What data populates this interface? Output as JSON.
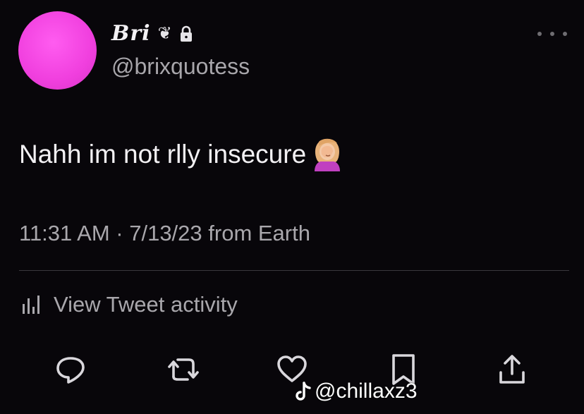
{
  "profile": {
    "display_name": "Bri",
    "name_glyph": "❦",
    "handle": "@brixquotess",
    "avatar_color": "#f03fde"
  },
  "tweet": {
    "text": "Nahh im not rlly insecure",
    "emoji": "face-palm-emoji",
    "meta": "11:31 AM · 7/13/23 from Earth"
  },
  "activity": {
    "label": "View Tweet activity",
    "icon": "bar-chart-icon"
  },
  "actions": [
    {
      "name": "reply",
      "icon": "reply-icon"
    },
    {
      "name": "retweet",
      "icon": "retweet-icon"
    },
    {
      "name": "like",
      "icon": "heart-icon"
    },
    {
      "name": "bookmark",
      "icon": "bookmark-icon"
    },
    {
      "name": "share",
      "icon": "share-icon"
    }
  ],
  "watermark": {
    "text": "@chillaxz3",
    "icon": "tiktok-icon"
  },
  "colors": {
    "background": "#08060a",
    "text_primary": "#f2f0f3",
    "text_secondary": "#a9a7ac",
    "accent_pink": "#f03fde"
  }
}
